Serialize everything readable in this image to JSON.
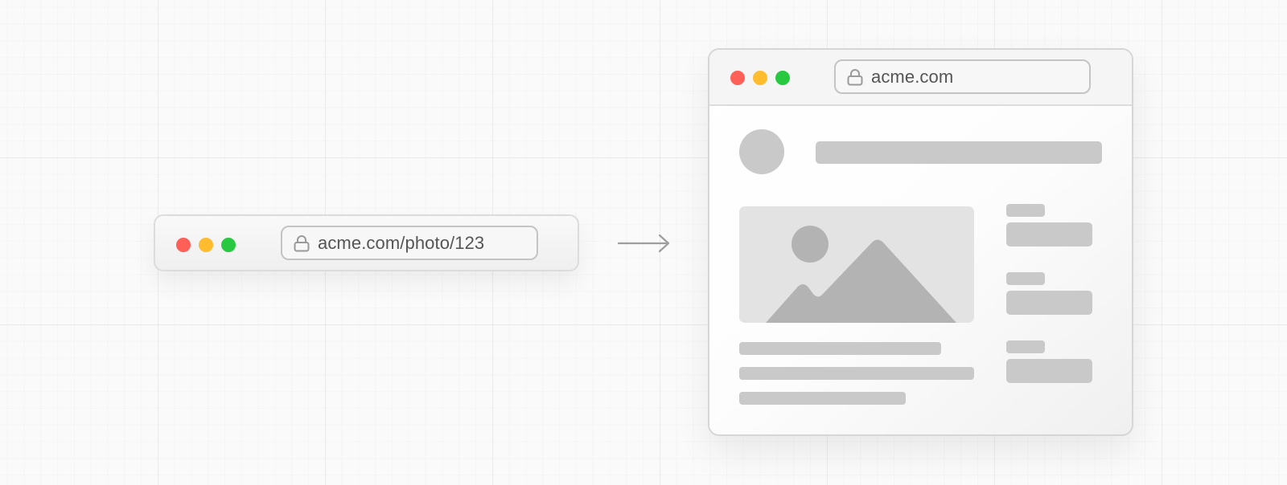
{
  "small_browser": {
    "url": "acme.com/photo/123",
    "icons": [
      "close-dot",
      "minimize-dot",
      "maximize-dot",
      "lock-icon"
    ]
  },
  "arrow": {
    "icon": "arrow-right-icon"
  },
  "large_browser": {
    "url": "acme.com",
    "icons": [
      "close-dot",
      "minimize-dot",
      "maximize-dot",
      "lock-icon",
      "image-placeholder-icon"
    ]
  },
  "colors": {
    "close": "#fe5f57",
    "minimize": "#febc2e",
    "maximize": "#28c840",
    "skeleton": "#c9c9c9",
    "image_bg": "#e3e3e3",
    "image_shapes": "#b3b3b3"
  }
}
